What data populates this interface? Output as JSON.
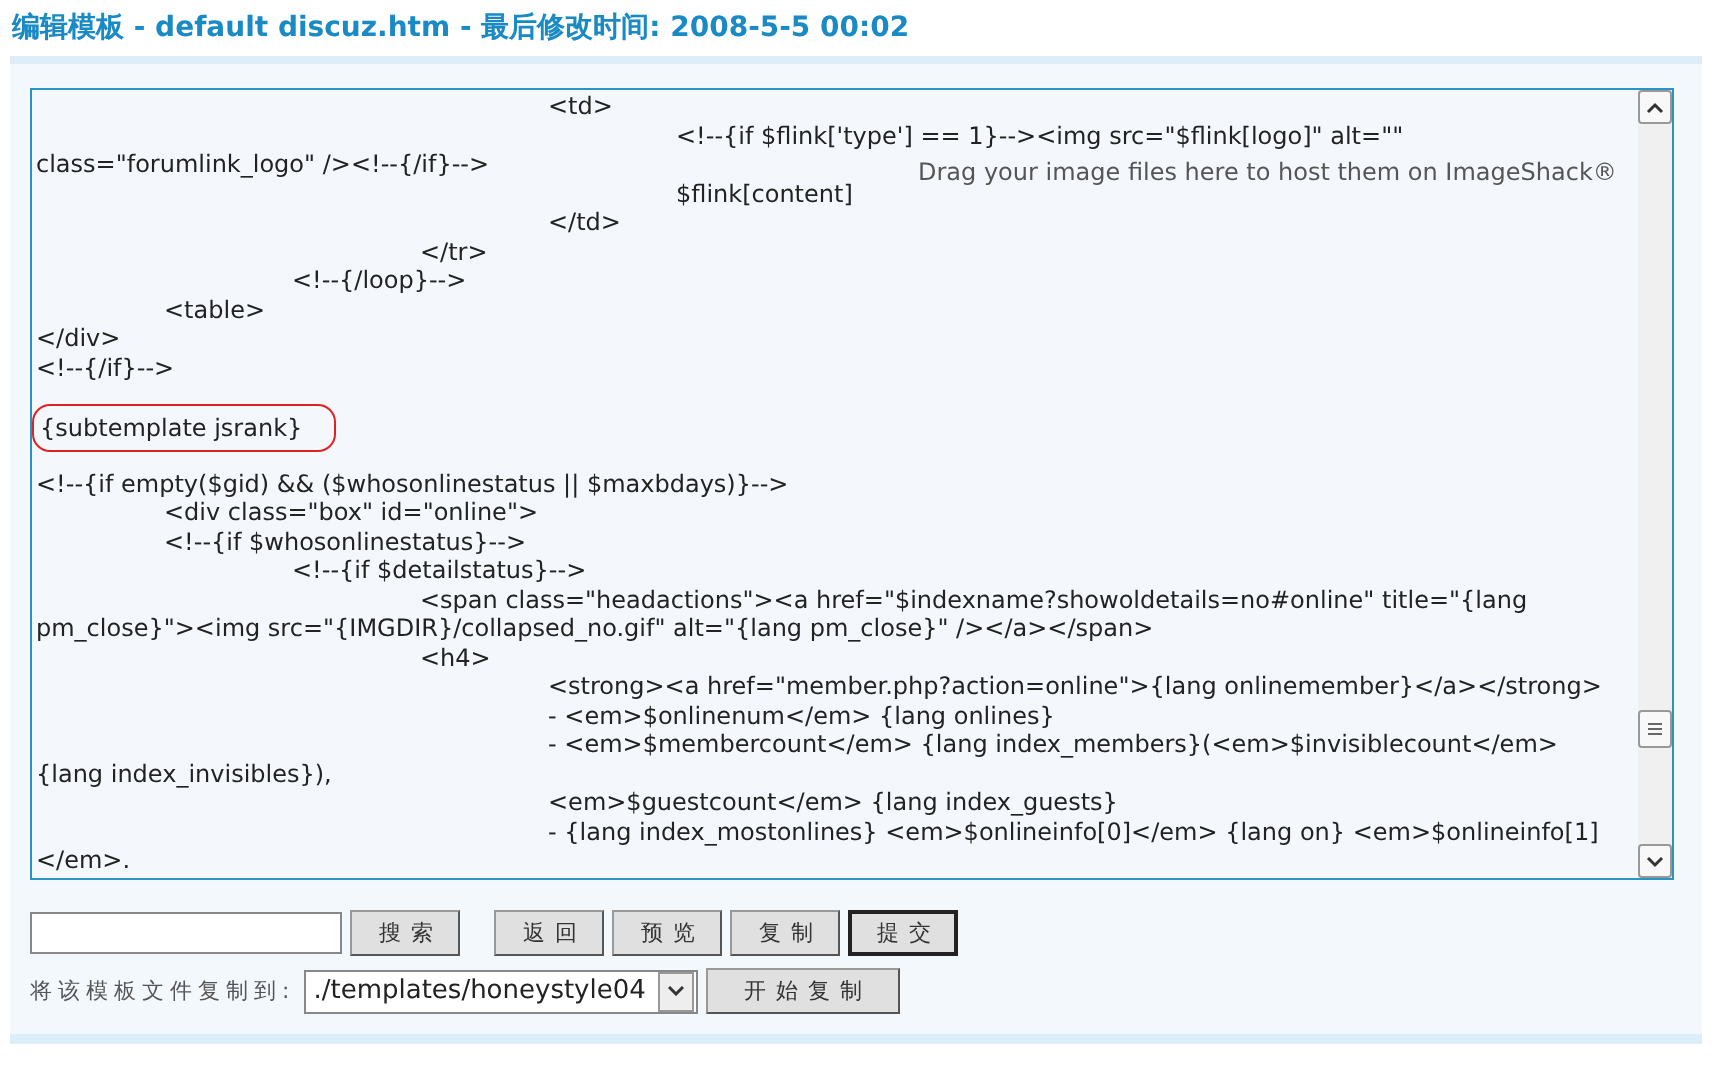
{
  "title": "编辑模板 - default discuz.htm - 最后修改时间: 2008-5-5 00:02",
  "editor": {
    "drop_hint": "Drag your image files here to host them on ImageShack®",
    "lines": [
      {
        "kind": "code",
        "text": "\t\t\t\t<td>"
      },
      {
        "kind": "code",
        "text": "\t\t\t\t\t<!--{if $flink['type'] == 1}--><img src=\"$flink[logo]\" alt=\"\""
      },
      {
        "kind": "code",
        "text": "class=\"forumlink_logo\" /><!--{/if}-->"
      },
      {
        "kind": "code",
        "text": "\t\t\t\t\t$flink[content]"
      },
      {
        "kind": "code",
        "text": "\t\t\t\t</td>"
      },
      {
        "kind": "code",
        "text": "\t\t\t</tr>"
      },
      {
        "kind": "code",
        "text": "\t\t<!--{/loop}-->"
      },
      {
        "kind": "code",
        "text": "\t<table>"
      },
      {
        "kind": "code",
        "text": "</div>"
      },
      {
        "kind": "code",
        "text": "<!--{/if}-->"
      },
      {
        "kind": "blank"
      },
      {
        "kind": "circled",
        "text": "{subtemplate jsrank}"
      },
      {
        "kind": "blank"
      },
      {
        "kind": "code",
        "text": "<!--{if empty($gid) && ($whosonlinestatus || $maxbdays)}-->"
      },
      {
        "kind": "code",
        "text": "\t<div class=\"box\" id=\"online\">"
      },
      {
        "kind": "code",
        "text": "\t<!--{if $whosonlinestatus}-->"
      },
      {
        "kind": "code",
        "text": "\t\t<!--{if $detailstatus}-->"
      },
      {
        "kind": "code",
        "text": "\t\t\t<span class=\"headactions\"><a href=\"$indexname?showoldetails=no#online\" title=\"{lang"
      },
      {
        "kind": "code",
        "text": "pm_close}\"><img src=\"{IMGDIR}/collapsed_no.gif\" alt=\"{lang pm_close}\" /></a></span>"
      },
      {
        "kind": "code",
        "text": "\t\t\t<h4>"
      },
      {
        "kind": "code",
        "text": "\t\t\t\t<strong><a href=\"member.php?action=online\">{lang onlinemember}</a></strong>"
      },
      {
        "kind": "code",
        "text": "\t\t\t\t- <em>$onlinenum</em> {lang onlines}"
      },
      {
        "kind": "code",
        "text": "\t\t\t\t- <em>$membercount</em> {lang index_members}(<em>$invisiblecount</em>"
      },
      {
        "kind": "code",
        "text": "{lang index_invisibles}),"
      },
      {
        "kind": "code",
        "text": "\t\t\t\t<em>$guestcount</em> {lang index_guests}"
      },
      {
        "kind": "code",
        "text": "\t\t\t\t- {lang index_mostonlines} <em>$onlineinfo[0]</em> {lang on} <em>$onlineinfo[1]"
      },
      {
        "kind": "code",
        "text": "</em>."
      }
    ]
  },
  "buttons": [
    {
      "label": "返回",
      "default": false
    },
    {
      "label": "预览",
      "default": false
    },
    {
      "label": "复制",
      "default": false
    },
    {
      "label": "提交",
      "default": true
    }
  ],
  "search_button": "搜索",
  "copy_row": {
    "label": "将该模板文件复制到:",
    "select_value": "./templates/honeystyle04",
    "button": "开始复制"
  }
}
